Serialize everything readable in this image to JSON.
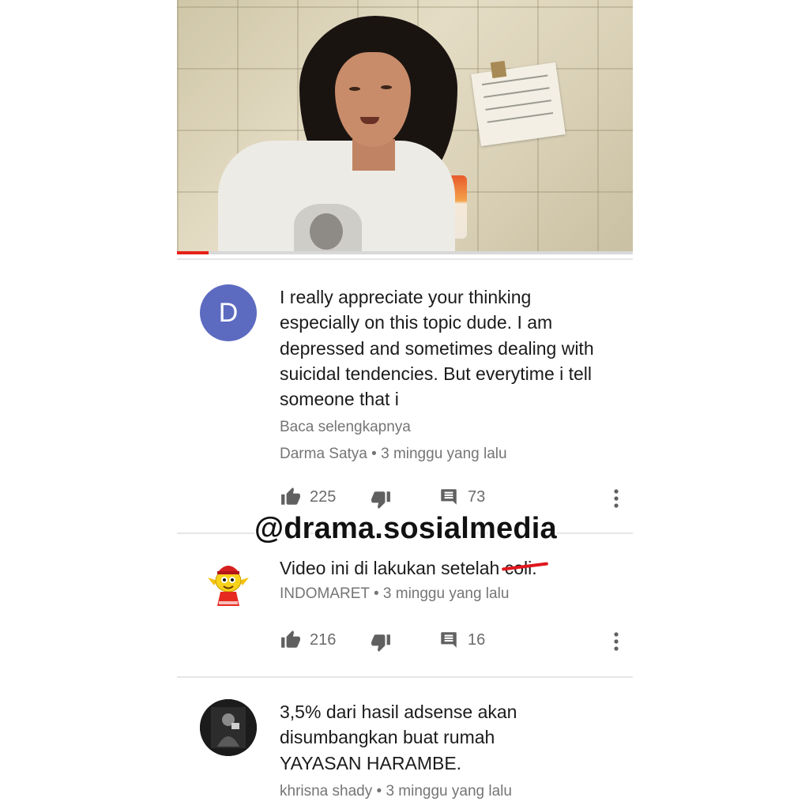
{
  "video": {
    "progress_fraction": 0.07,
    "progress_color": "#e62117"
  },
  "comments": [
    {
      "avatar_letter": "D",
      "avatar_color": "#5c6bc0",
      "text": "I really appreciate your thinking especially on this topic dude. I am depressed and sometimes dealing with suicidal tendencies. But everytime i tell someone that i",
      "read_more": "Baca selengkapnya",
      "author": "Darma Satya",
      "time": "3 minggu yang lalu",
      "likes": "225",
      "replies": "73"
    },
    {
      "avatar_icon": "indomaret-mascot-icon",
      "text": "Video ini di lakukan setelah",
      "struck_text": "coli.",
      "author": "INDOMARET",
      "time": "3 minggu yang lalu",
      "likes": "216",
      "replies": "16"
    },
    {
      "avatar_icon": "profile-photo-icon",
      "text": "3,5% dari hasil adsense akan disumbangkan buat rumah YAYASAN HARAMBE.",
      "author": "khrisna shady",
      "time": "3 minggu yang lalu"
    }
  ],
  "meta_separator": "•",
  "watermark": "@drama.sosialmedia",
  "icons": {
    "like": "thumbs-up-icon",
    "dislike": "thumbs-down-icon",
    "reply": "comment-icon",
    "more": "more-vert-icon"
  }
}
